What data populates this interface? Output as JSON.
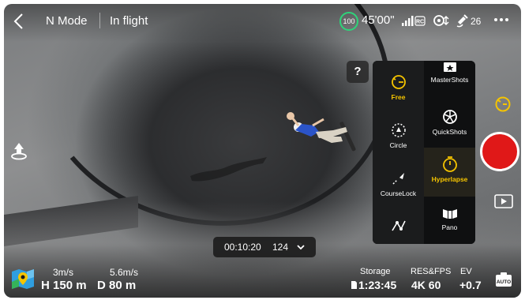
{
  "top_bar": {
    "mode": "N Mode",
    "flight_status": "In flight",
    "battery_percent": "100",
    "flight_time": "45'00\"",
    "signal_label": "RC",
    "gps_count": "26"
  },
  "help": {
    "label": "?"
  },
  "intelligent_panel": {
    "left_items": [
      {
        "label": "Free",
        "icon": "free-icon",
        "active": true
      },
      {
        "label": "Circle",
        "icon": "circle-icon",
        "active": false
      },
      {
        "label": "CourseLock",
        "icon": "courselock-icon",
        "active": false
      },
      {
        "label": "Waypoint",
        "icon": "waypoint-icon",
        "active": false
      }
    ],
    "right_items": [
      {
        "label": "MasterShots",
        "icon": "mastershots-icon",
        "active": false
      },
      {
        "label": "QuickShots",
        "icon": "quickshots-icon",
        "active": false
      },
      {
        "label": "Hyperlapse",
        "icon": "hyperlapse-icon",
        "active": true
      },
      {
        "label": "Pano",
        "icon": "pano-icon",
        "active": false
      }
    ]
  },
  "duration": {
    "time": "00:10:20",
    "count": "124"
  },
  "telemetry": {
    "horizontal_speed": "3m/s",
    "vertical_speed": "5.6m/s",
    "height_label": "H",
    "height_value": "150 m",
    "distance_label": "D",
    "distance_value": "80 m"
  },
  "camera": {
    "storage_label": "Storage",
    "storage_value": "1:23:45",
    "resfps_label": "RES&FPS",
    "resfps_value": "4K 60",
    "ev_label": "EV",
    "ev_value": "+0.7"
  },
  "colors": {
    "accent": "#f5c400",
    "battery": "#2ed47a",
    "shutter": "#e01818"
  }
}
